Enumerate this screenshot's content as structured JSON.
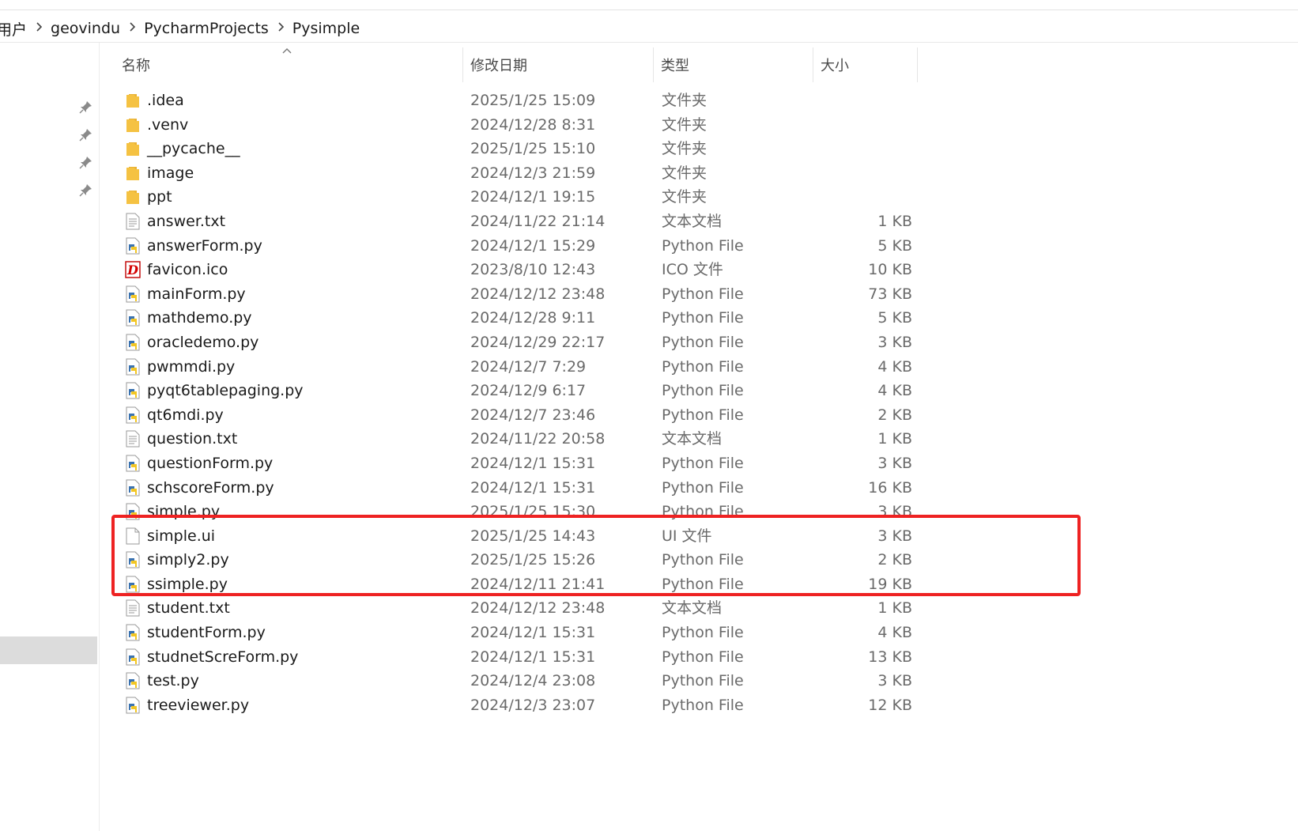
{
  "breadcrumb": [
    "用户",
    "geovindu",
    "PycharmProjects",
    "Pysimple"
  ],
  "columns": {
    "name": "名称",
    "date": "修改日期",
    "type": "类型",
    "size": "大小"
  },
  "files": [
    {
      "name": ".idea",
      "date": "2025/1/25 15:09",
      "type": "文件夹",
      "size": "",
      "icon": "folder-icon"
    },
    {
      "name": ".venv",
      "date": "2024/12/28 8:31",
      "type": "文件夹",
      "size": "",
      "icon": "folder-icon"
    },
    {
      "name": "__pycache__",
      "date": "2025/1/25 15:10",
      "type": "文件夹",
      "size": "",
      "icon": "folder-icon"
    },
    {
      "name": "image",
      "date": "2024/12/3 21:59",
      "type": "文件夹",
      "size": "",
      "icon": "folder-icon"
    },
    {
      "name": "ppt",
      "date": "2024/12/1 19:15",
      "type": "文件夹",
      "size": "",
      "icon": "folder-icon"
    },
    {
      "name": "answer.txt",
      "date": "2024/11/22 21:14",
      "type": "文本文档",
      "size": "1 KB",
      "icon": "text-file-icon"
    },
    {
      "name": "answerForm.py",
      "date": "2024/12/1 15:29",
      "type": "Python File",
      "size": "5 KB",
      "icon": "python-file-icon"
    },
    {
      "name": "favicon.ico",
      "date": "2023/8/10 12:43",
      "type": "ICO 文件",
      "size": "10 KB",
      "icon": "ico-file-icon"
    },
    {
      "name": "mainForm.py",
      "date": "2024/12/12 23:48",
      "type": "Python File",
      "size": "73 KB",
      "icon": "python-file-icon"
    },
    {
      "name": "mathdemo.py",
      "date": "2024/12/28 9:11",
      "type": "Python File",
      "size": "5 KB",
      "icon": "python-file-icon"
    },
    {
      "name": "oracledemo.py",
      "date": "2024/12/29 22:17",
      "type": "Python File",
      "size": "3 KB",
      "icon": "python-file-icon"
    },
    {
      "name": "pwmmdi.py",
      "date": "2024/12/7 7:29",
      "type": "Python File",
      "size": "4 KB",
      "icon": "python-file-icon"
    },
    {
      "name": "pyqt6tablepaging.py",
      "date": "2024/12/9 6:17",
      "type": "Python File",
      "size": "4 KB",
      "icon": "python-file-icon"
    },
    {
      "name": "qt6mdi.py",
      "date": "2024/12/7 23:46",
      "type": "Python File",
      "size": "2 KB",
      "icon": "python-file-icon"
    },
    {
      "name": "question.txt",
      "date": "2024/11/22 20:58",
      "type": "文本文档",
      "size": "1 KB",
      "icon": "text-file-icon"
    },
    {
      "name": "questionForm.py",
      "date": "2024/12/1 15:31",
      "type": "Python File",
      "size": "3 KB",
      "icon": "python-file-icon"
    },
    {
      "name": "schscoreForm.py",
      "date": "2024/12/1 15:31",
      "type": "Python File",
      "size": "16 KB",
      "icon": "python-file-icon"
    },
    {
      "name": "simple.py",
      "date": "2025/1/25 15:30",
      "type": "Python File",
      "size": "3 KB",
      "icon": "python-file-icon"
    },
    {
      "name": "simple.ui",
      "date": "2025/1/25 14:43",
      "type": "UI 文件",
      "size": "3 KB",
      "icon": "blank-file-icon"
    },
    {
      "name": "simply2.py",
      "date": "2025/1/25 15:26",
      "type": "Python File",
      "size": "2 KB",
      "icon": "python-file-icon"
    },
    {
      "name": "ssimple.py",
      "date": "2024/12/11 21:41",
      "type": "Python File",
      "size": "19 KB",
      "icon": "python-file-icon"
    },
    {
      "name": "student.txt",
      "date": "2024/12/12 23:48",
      "type": "文本文档",
      "size": "1 KB",
      "icon": "text-file-icon"
    },
    {
      "name": "studentForm.py",
      "date": "2024/12/1 15:31",
      "type": "Python File",
      "size": "4 KB",
      "icon": "python-file-icon"
    },
    {
      "name": "studnetScreForm.py",
      "date": "2024/12/1 15:31",
      "type": "Python File",
      "size": "13 KB",
      "icon": "python-file-icon"
    },
    {
      "name": "test.py",
      "date": "2024/12/4 23:08",
      "type": "Python File",
      "size": "3 KB",
      "icon": "python-file-icon"
    },
    {
      "name": "treeviewer.py",
      "date": "2024/12/3 23:07",
      "type": "Python File",
      "size": "12 KB",
      "icon": "python-file-icon"
    }
  ],
  "highlighted_files": [
    "simple.py",
    "simple.ui",
    "simply2.py"
  ],
  "highlight_color": "#ee2222",
  "folder_color": "#f5c242"
}
